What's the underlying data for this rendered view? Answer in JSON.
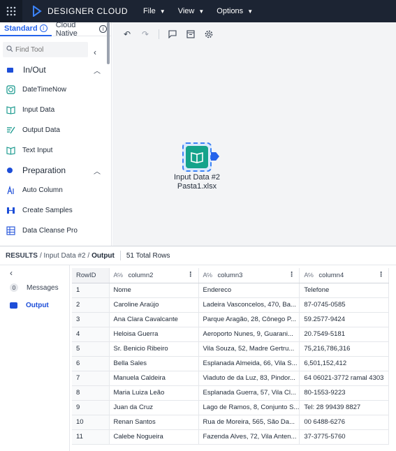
{
  "app": {
    "title": "DESIGNER CLOUD"
  },
  "menu": [
    {
      "label": "File"
    },
    {
      "label": "View"
    },
    {
      "label": "Options"
    }
  ],
  "palette": {
    "tabs": [
      {
        "label": "Standard"
      },
      {
        "label": "Cloud Native"
      }
    ],
    "search_placeholder": "Find Tool",
    "categories": [
      {
        "label": "In/Out",
        "tools": [
          {
            "label": "DateTimeNow",
            "icon": "clock-icon"
          },
          {
            "label": "Input Data",
            "icon": "book-icon"
          },
          {
            "label": "Output Data",
            "icon": "output-icon"
          },
          {
            "label": "Text Input",
            "icon": "text-input-icon"
          }
        ]
      },
      {
        "label": "Preparation",
        "tools": [
          {
            "label": "Auto Column",
            "icon": "auto-column-icon"
          },
          {
            "label": "Create Samples",
            "icon": "samples-icon"
          },
          {
            "label": "Data Cleanse Pro",
            "icon": "cleanse-icon"
          }
        ]
      }
    ]
  },
  "canvas": {
    "node": {
      "title": "Input Data #2",
      "subtitle": "Pasta1.xlsx"
    }
  },
  "results": {
    "label": "RESULTS",
    "path": "/ Input Data #2 /",
    "output": "Output",
    "total_rows": "51 Total Rows",
    "nav": [
      {
        "label": "Messages",
        "badge": "0"
      },
      {
        "label": "Output"
      }
    ],
    "columns": [
      "RowID",
      "column2",
      "column3",
      "column4"
    ],
    "rows": [
      [
        "1",
        "Nome",
        "Endereco",
        "Telefone"
      ],
      [
        "2",
        "Caroline Araújo",
        "Ladeira Vasconcelos, 470, Ba...",
        "87-0745-0585"
      ],
      [
        "3",
        "Ana Clara Cavalcante",
        "Parque Aragão, 28, Cônego P...",
        "59.2577-9424"
      ],
      [
        "4",
        "Heloisa Guerra",
        "Aeroporto Nunes, 9, Guarani...",
        "20.7549-5181"
      ],
      [
        "5",
        "Sr. Benicio Ribeiro",
        "Vila Souza, 52, Madre Gertru...",
        "75,216,786,316"
      ],
      [
        "6",
        "Bella Sales",
        "Esplanada Almeida, 66, Vila S...",
        "6,501,152,412"
      ],
      [
        "7",
        "Manuela Caldeira",
        "Viaduto de da Luz, 83, Pindor...",
        "64 06021-3772 ramal 4303"
      ],
      [
        "8",
        "Maria Luiza Leão",
        "Esplanada Guerra, 57, Vila Cl...",
        "80-1553-9223"
      ],
      [
        "9",
        "Juan da Cruz",
        "Lago de Ramos, 8, Conjunto S...",
        "Tel: 28 99439 8827"
      ],
      [
        "10",
        "Renan Santos",
        "Rua de Moreira, 565, São Da...",
        "00 6488-6276"
      ],
      [
        "11",
        "Calebe Nogueira",
        "Fazenda Alves, 72, Vila Anten...",
        "37-3775-5760"
      ]
    ]
  }
}
